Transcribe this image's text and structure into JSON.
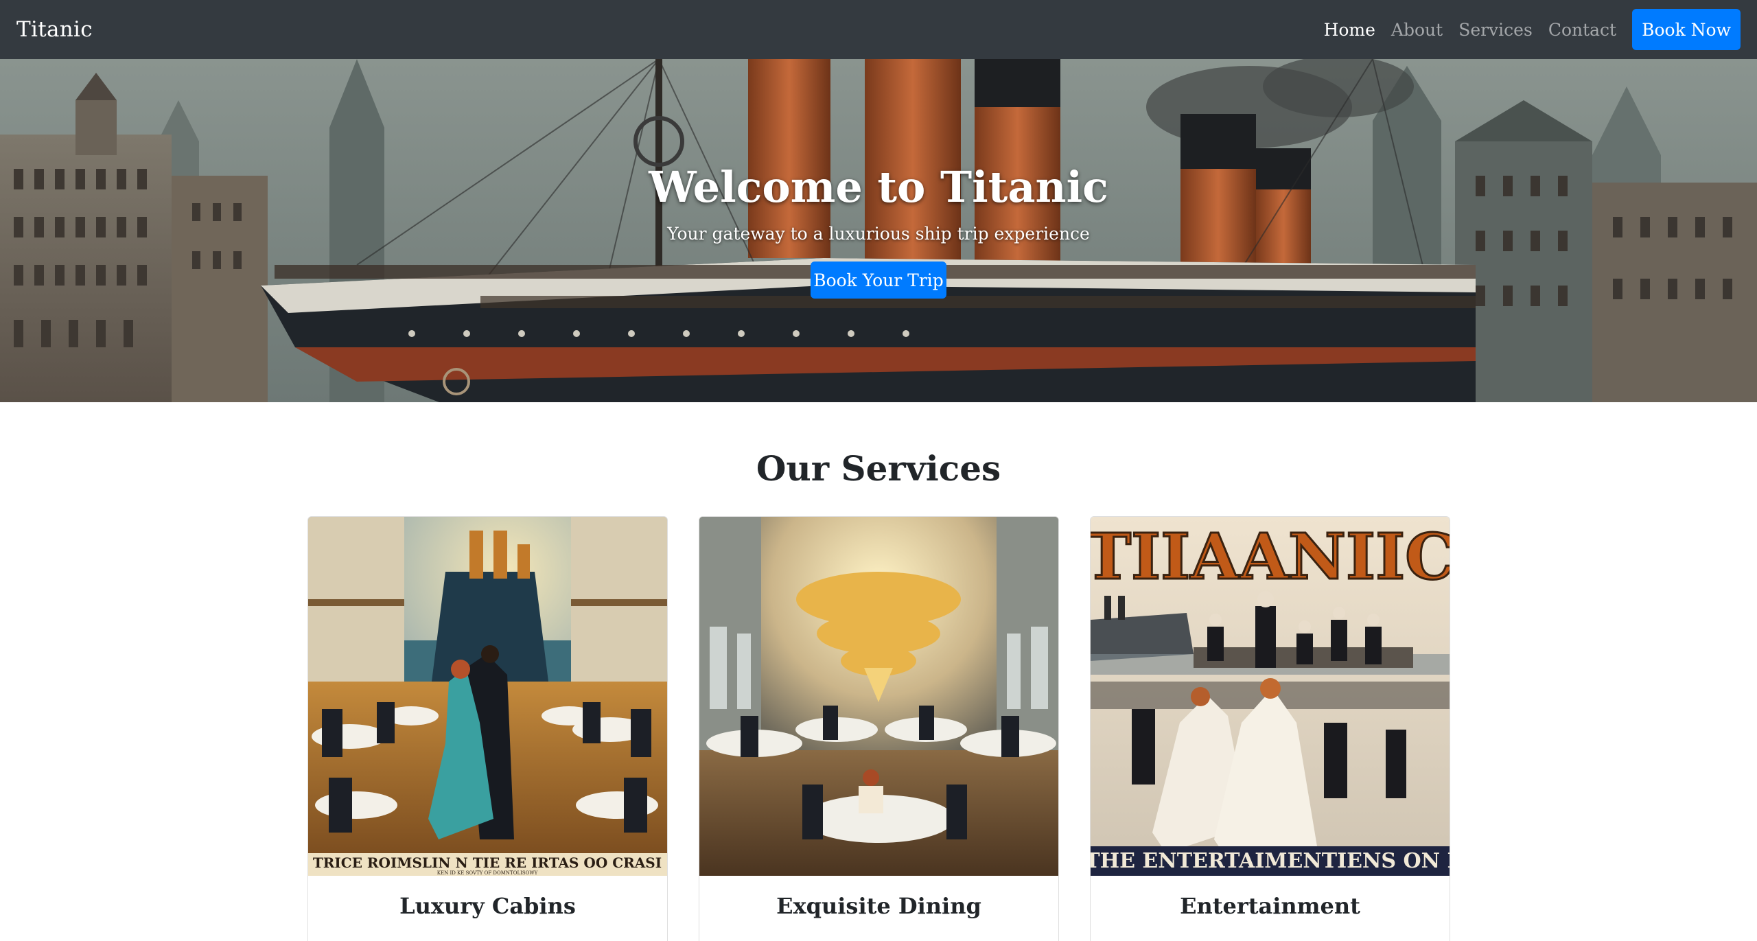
{
  "navbar": {
    "brand": "Titanic",
    "links": [
      "Home",
      "About",
      "Services",
      "Contact"
    ],
    "cta": "Book Now"
  },
  "hero": {
    "title": "Welcome to Titanic",
    "subtitle": "Your gateway to a luxurious ship trip experience",
    "button": "Book Your Trip"
  },
  "services": {
    "title": "Our Services",
    "cards": [
      {
        "title": "Luxury Cabins",
        "image_caption": "TRICE ROIMSLIN N TIE RE IRTAS OO CRASI",
        "image_subcaption": "KEN ID KE SOVTY OF DOMNTOLISOWY",
        "text": ""
      },
      {
        "title": "Exquisite Dining",
        "text": ""
      },
      {
        "title": "Entertainment",
        "image_caption": "E THE ENTERTAIMENTIENS ON LA",
        "image_header": "TIIAANIIC",
        "text": ""
      }
    ]
  },
  "colors": {
    "navbar_bg": "#343a40",
    "primary": "#007bff",
    "text": "#212529"
  }
}
